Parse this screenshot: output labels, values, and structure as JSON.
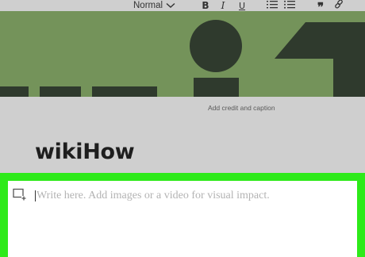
{
  "toolbar": {
    "style_select_value": "Normal",
    "bold_label": "B",
    "italic_label": "I",
    "underline_label": "U",
    "quote_label": "❞",
    "icons": [
      "chevron-down-icon",
      "ordered-list-icon",
      "bullet-list-icon",
      "link-icon"
    ]
  },
  "banner": {
    "colors": {
      "background": "#74935a",
      "shapes": "#2f3a2d"
    }
  },
  "caption": {
    "text": "Add credit and caption"
  },
  "article": {
    "title": "wikiHow"
  },
  "editor": {
    "placeholder": "Write here. Add images or a video for visual impact.",
    "add_media_icon": "add-media-icon",
    "highlight_color": "#2eea1a"
  }
}
